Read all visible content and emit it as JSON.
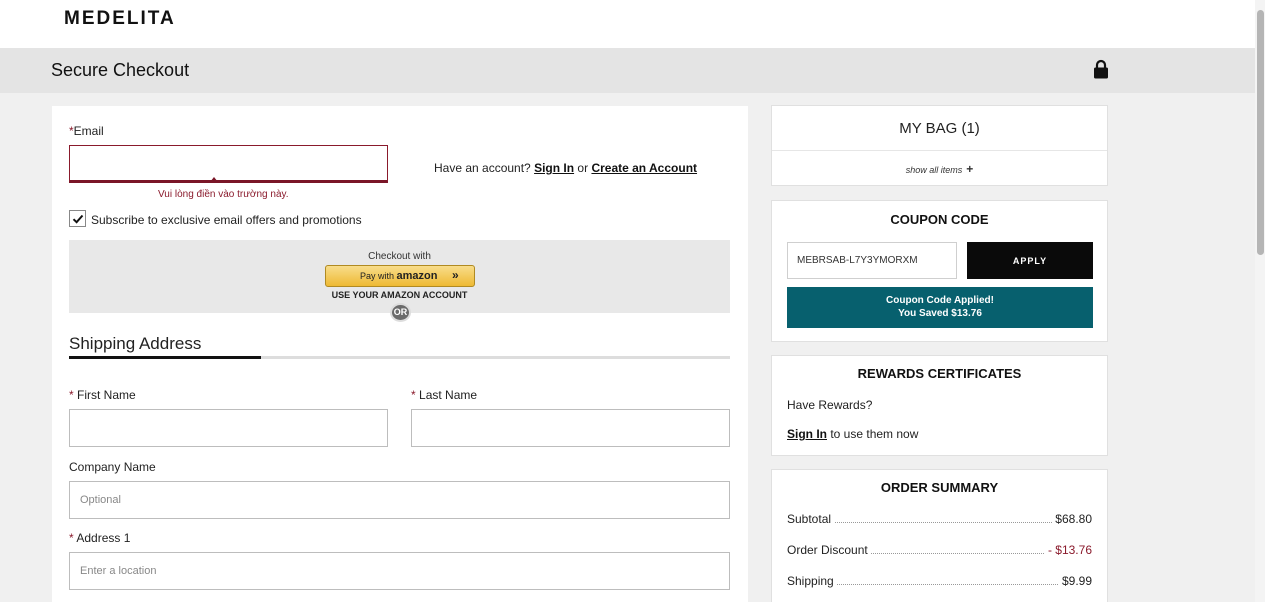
{
  "header": {
    "logo": "MEDELITA",
    "checkout_title": "Secure Checkout"
  },
  "contact": {
    "email_label": "Email",
    "email_value": "",
    "email_error": "Vui lòng điền vào trường này.",
    "have_account": "Have an account?",
    "sign_in": "Sign In",
    "or": "or",
    "create_account": "Create an Account",
    "subscribe_label": "Subscribe to exclusive email offers and promotions",
    "subscribe_checked": true
  },
  "amazon": {
    "checkout_with": "Checkout with",
    "pay_with": "Pay with",
    "brand": "amazon",
    "arrows": "»",
    "use_account": "USE YOUR AMAZON ACCOUNT",
    "or_badge": "OR"
  },
  "shipping": {
    "heading": "Shipping Address",
    "first_name_label": "First Name",
    "last_name_label": "Last Name",
    "company_label": "Company Name",
    "company_placeholder": "Optional",
    "address1_label": "Address 1",
    "address1_placeholder": "Enter a location",
    "required_mark": "*"
  },
  "bag": {
    "title": "MY BAG (1)",
    "show_all": "show all items",
    "plus": "+"
  },
  "coupon": {
    "title": "COUPON CODE",
    "code_value": "MEBRSAB-L7Y3YMORXM",
    "apply_label": "APPLY",
    "applied_line1": "Coupon Code Applied!",
    "applied_line2": "You Saved $13.76"
  },
  "rewards": {
    "title": "REWARDS CERTIFICATES",
    "have_rewards": "Have Rewards?",
    "sign_in": "Sign In",
    "suffix": "to use them now"
  },
  "summary": {
    "title": "ORDER SUMMARY",
    "rows": [
      {
        "label": "Subtotal",
        "value": "$68.80"
      },
      {
        "label": "Order Discount",
        "value": "- $13.76"
      },
      {
        "label": "Shipping",
        "value": "$9.99"
      }
    ]
  },
  "colors": {
    "error": "#8a1a2c",
    "coupon_applied_bg": "#07606e",
    "apply_bg": "#0a0a0a"
  }
}
